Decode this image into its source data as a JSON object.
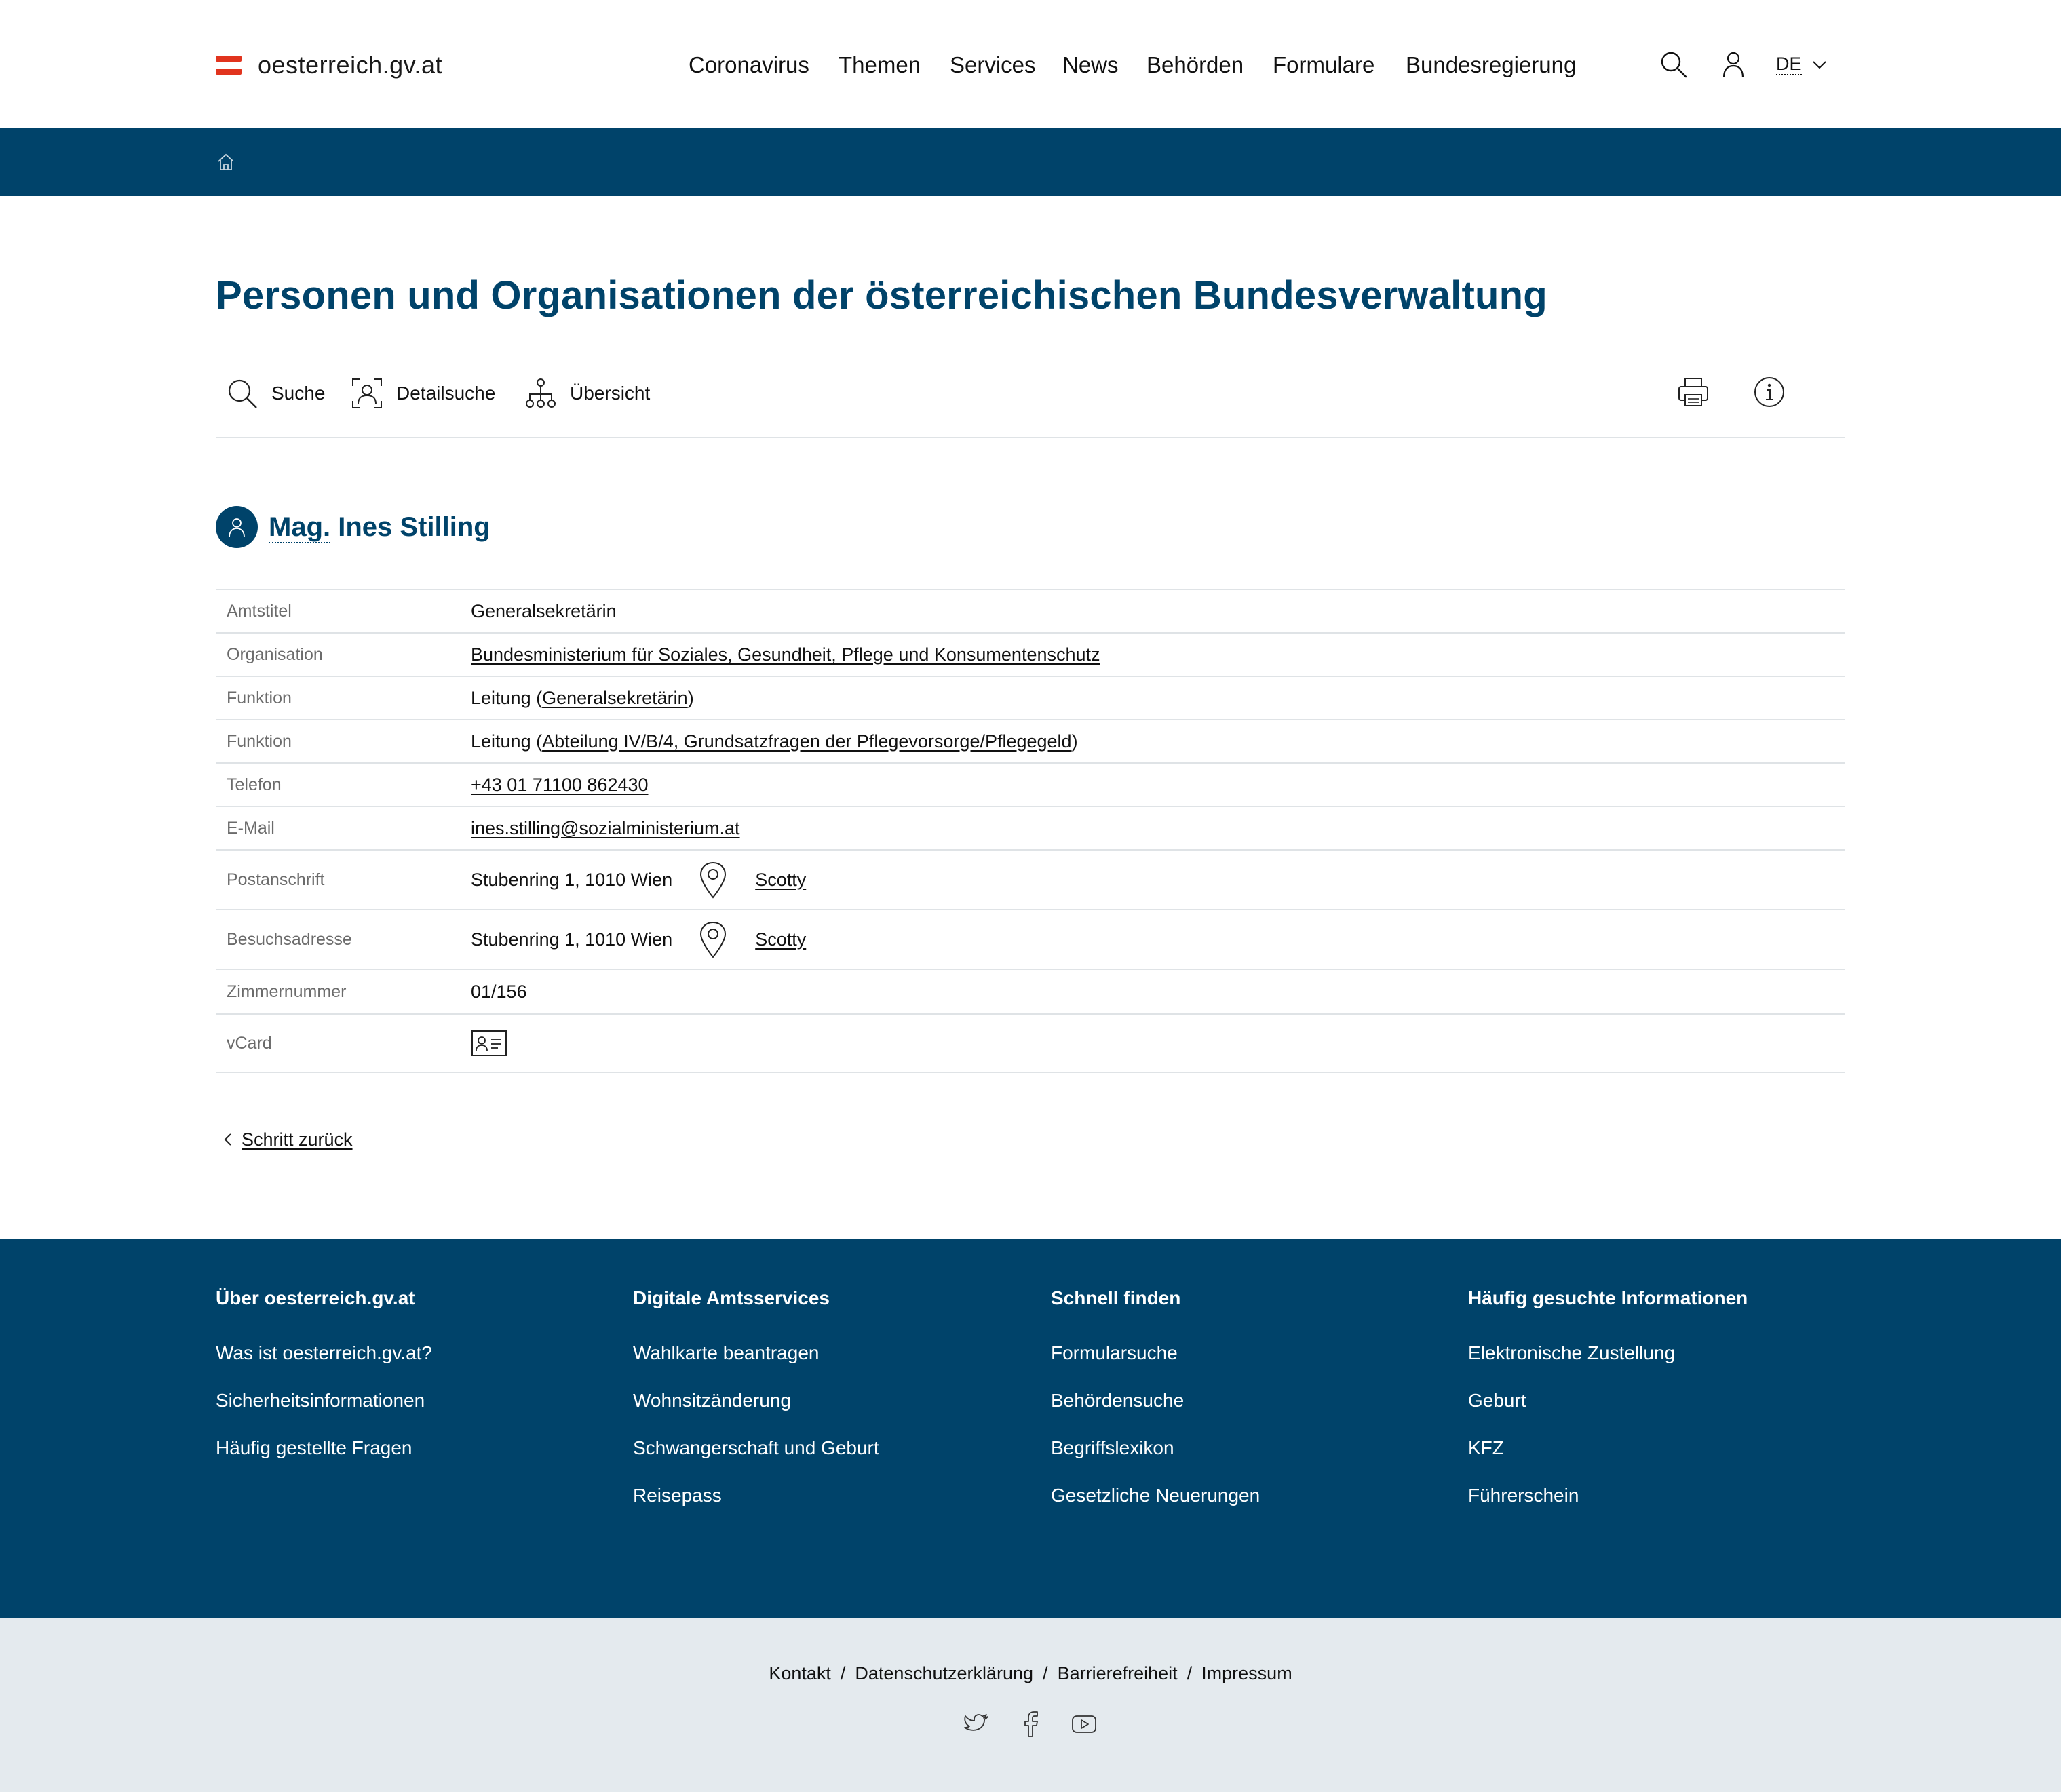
{
  "header": {
    "logo_text": "oesterreich.gv.at",
    "nav": [
      "Coronavirus",
      "Themen",
      "Services",
      "News",
      "Behörden",
      "Formulare",
      "Bundesregierung"
    ],
    "lang": "DE",
    "icons": [
      "search-icon",
      "user-icon",
      "chevron-down-icon"
    ]
  },
  "breadcrumb": {
    "icon": "home-icon"
  },
  "page_title": "Personen und Organisationen der österreichischen Bundesverwaltung",
  "toolbar": {
    "suche": "Suche",
    "detailsuche": "Detailsuche",
    "uebersicht": "Übersicht",
    "icons": [
      "search-icon",
      "face-scan-icon",
      "org-chart-icon",
      "print-icon",
      "info-icon"
    ]
  },
  "person": {
    "title": "Mag.",
    "name": "Ines Stilling"
  },
  "details": {
    "amtstitel": {
      "label": "Amtstitel",
      "value": "Generalsekretärin"
    },
    "organisation": {
      "label": "Organisation",
      "value": "Bundesministerium für Soziales, Gesundheit, Pflege und Konsumentenschutz"
    },
    "funktion1": {
      "label": "Funktion",
      "prefix": "Leitung (",
      "link": "Generalsekretärin",
      "suffix": ")"
    },
    "funktion2": {
      "label": "Funktion",
      "prefix": "Leitung (",
      "link": "Abteilung IV/B/4, Grundsatzfragen der Pflegevorsorge/Pflegegeld",
      "suffix": ")"
    },
    "telefon": {
      "label": "Telefon",
      "value": "+43 01 71100 862430"
    },
    "email": {
      "label": "E-Mail",
      "value": "ines.stilling@sozialministerium.at"
    },
    "postanschrift": {
      "label": "Postanschrift",
      "value": "Stubenring 1, 1010 Wien",
      "map_link": "Scotty"
    },
    "besuchsadresse": {
      "label": "Besuchsadresse",
      "value": "Stubenring 1, 1010 Wien",
      "map_link": "Scotty"
    },
    "zimmernummer": {
      "label": "Zimmernummer",
      "value": "01/156"
    },
    "vcard": {
      "label": "vCard",
      "icon": "vcard-icon"
    }
  },
  "back_link": "Schritt zurück",
  "footer": {
    "col1": {
      "heading": "Über oesterreich.gv.at",
      "links": [
        "Was ist oesterreich.gv.at?",
        "Sicherheitsinformationen",
        "Häufig gestellte Fragen"
      ]
    },
    "col2": {
      "heading": "Digitale Amtsservices",
      "links": [
        "Wahlkarte beantragen",
        "Wohnsitzänderung",
        "Schwangerschaft und Geburt",
        "Reisepass"
      ]
    },
    "col3": {
      "heading": "Schnell finden",
      "links": [
        "Formularsuche",
        "Behördensuche",
        "Begriffslexikon",
        "Gesetzliche Neuerungen"
      ]
    },
    "col4": {
      "heading": "Häufig gesuchte Informationen",
      "links": [
        "Elektronische Zustellung",
        "Geburt",
        "KFZ",
        "Führerschein"
      ]
    }
  },
  "legal": {
    "links": [
      "Kontakt",
      "Datenschutzerklärung",
      "Barrierefreiheit",
      "Impressum"
    ],
    "separator": "/"
  },
  "social": [
    "twitter-icon",
    "facebook-icon",
    "youtube-icon"
  ],
  "colors": {
    "brand_blue": "#00436a",
    "flag_red": "#e1341e",
    "subfooter_bg": "#e4eaee"
  }
}
